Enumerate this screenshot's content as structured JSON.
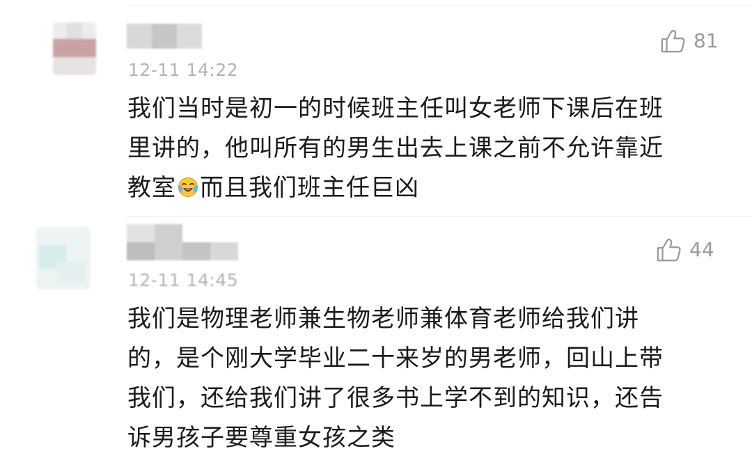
{
  "comments": [
    {
      "timestamp": "12-11 14:22",
      "likes": "81",
      "lines": [
        "我们当时是初一的时候班主任叫女老师下课后在班",
        "里讲的，他叫所有的男生出去上课之前不允许靠近",
        "教室"
      ],
      "after_emoji": "而且我们班主任巨凶",
      "emoji": "crying-laughing-emoji"
    },
    {
      "timestamp": "12-11 14:45",
      "likes": "44",
      "lines": [
        "我们是物理老师兼生物老师兼体育老师给我们讲",
        "的，是个刚大学毕业二十来岁的男老师，回山上带",
        "我们，还给我们讲了很多书上学不到的知识，还告",
        "诉男孩子要尊重女孩之类"
      ]
    }
  ],
  "colors": {
    "text": "#1a1a1a",
    "timestamp": "#b4b4b4",
    "like": "#9a9a9a",
    "divider": "#ececec"
  },
  "icons": {
    "like": "thumbs-up-icon"
  }
}
